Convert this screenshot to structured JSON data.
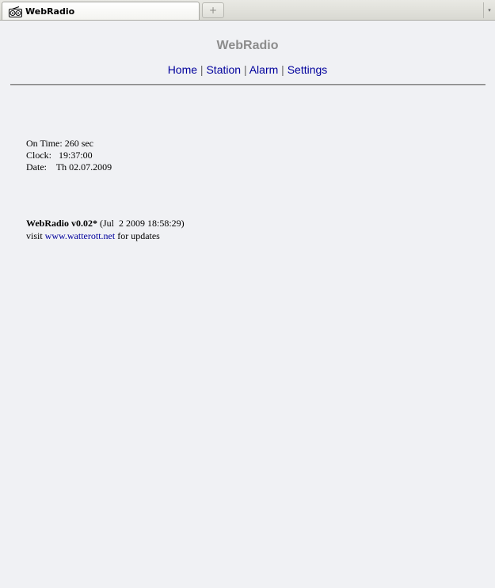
{
  "browser": {
    "tab_title": "WebRadio",
    "new_tab_glyph": "+",
    "tab_list_glyph": "▾"
  },
  "page": {
    "title": "WebRadio",
    "nav": [
      {
        "label": "Home"
      },
      {
        "label": "Station"
      },
      {
        "label": "Alarm"
      },
      {
        "label": "Settings"
      }
    ],
    "nav_separator": " | ",
    "status": {
      "on_time_label": "On Time:",
      "on_time_value": "260 sec",
      "clock_label": "Clock:",
      "clock_value": "19:37:00",
      "date_label": "Date:",
      "date_value": "Th 02.07.2009"
    },
    "footer": {
      "version": "WebRadio v0.02*",
      "build": "(Jul  2 2009 18:58:29)",
      "visit_prefix": "visit ",
      "link_text": "www.watterott.net",
      "visit_suffix": " for updates"
    }
  },
  "colors": {
    "background": "#f0f1f4",
    "link": "#00009c",
    "title_gray": "#8c8c8c"
  }
}
